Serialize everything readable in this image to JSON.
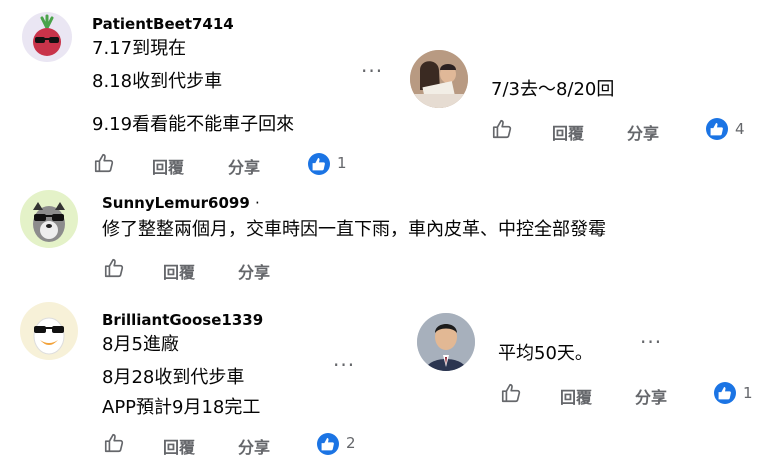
{
  "comments": [
    {
      "author": "PatientBeet7414",
      "lines": [
        "7.17到現在",
        "8.18收到代步車",
        "9.19看看能不能車子回來"
      ],
      "like_label": "讚",
      "reply_label": "回覆",
      "share_label": "分享",
      "reaction_count": "1",
      "reply": {
        "author": "",
        "text": "7/3去～8/20回",
        "reply_label": "回覆",
        "share_label": "分享",
        "reaction_count": "4"
      }
    },
    {
      "author": "SunnyLemur6099",
      "author_suffix": "·",
      "lines": [
        "修了整整兩個月，交車時因一直下雨，車內皮革、中控全部發霉"
      ],
      "reply_label": "回覆",
      "share_label": "分享"
    },
    {
      "author": "BrilliantGoose1339",
      "lines": [
        "8月5進廠",
        "8月28收到代步車",
        "APP預計9月18完工"
      ],
      "reply_label": "回覆",
      "share_label": "分享",
      "reaction_count": "2",
      "reply": {
        "text": "平均50天。",
        "reply_label": "回覆",
        "share_label": "分享",
        "reaction_count": "1"
      }
    }
  ],
  "more_icon": "more-dots-icon",
  "colors": {
    "like_blue": "#1b74e4",
    "secondary_text": "#65676b"
  }
}
